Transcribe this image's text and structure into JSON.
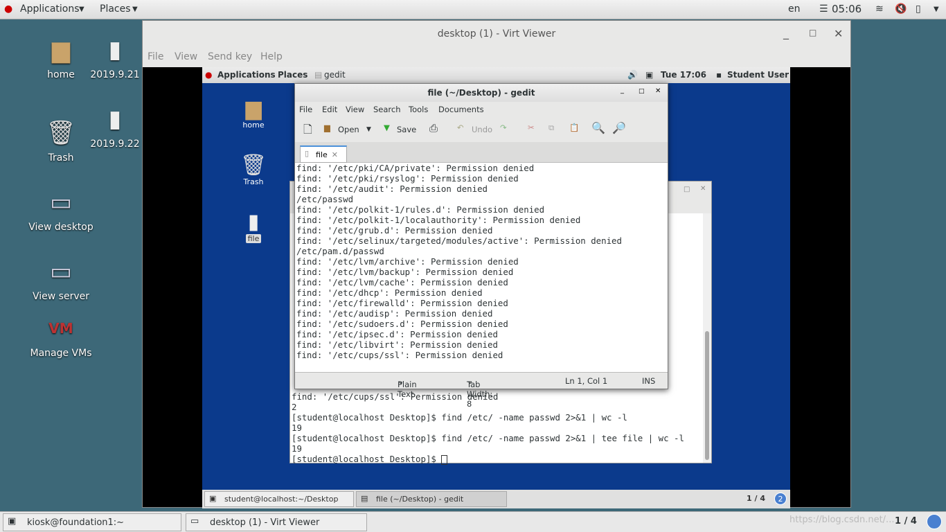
{
  "host_topbar": {
    "applications": "Applications",
    "places": "Places",
    "lang": "en",
    "time": "05:06"
  },
  "host_desktop": [
    {
      "label": "home",
      "icon": "folder-home-icon"
    },
    {
      "label": "2019.9.21",
      "icon": "file-icon"
    },
    {
      "label": "Trash",
      "icon": "trash-icon"
    },
    {
      "label": "2019.9.22",
      "icon": "file-icon"
    },
    {
      "label": "View desktop",
      "icon": "monitor-icon"
    },
    {
      "label": "View server",
      "icon": "monitor-icon"
    },
    {
      "label": "Manage VMs",
      "icon": "vm-icon"
    }
  ],
  "virt_viewer": {
    "title": "desktop (1) - Virt Viewer",
    "menu": [
      "File",
      "View",
      "Send key",
      "Help"
    ]
  },
  "guest_topbar": {
    "applications": "Applications",
    "places": "Places",
    "gedit": "gedit",
    "time": "Tue 17:06",
    "user": "Student User"
  },
  "guest_desktop": [
    {
      "label": "home"
    },
    {
      "label": "Trash"
    },
    {
      "label": "file"
    }
  ],
  "terminal": {
    "lines": [
      "find: '/etc/cups/ssl': Permission denied",
      "2",
      "[student@localhost Desktop]$ find /etc/ -name passwd 2>&1 | wc -l",
      "19",
      "[student@localhost Desktop]$ find /etc/ -name passwd 2>&1 | tee file | wc -l",
      "19",
      "[student@localhost Desktop]$ "
    ]
  },
  "gedit": {
    "title": "file (~/Desktop) - gedit",
    "menu": [
      "File",
      "Edit",
      "View",
      "Search",
      "Tools",
      "Documents"
    ],
    "toolbar": {
      "open": "Open",
      "save": "Save",
      "undo": "Undo"
    },
    "tab": "file",
    "lines": [
      "find: '/etc/pki/CA/private': Permission denied",
      "find: '/etc/pki/rsyslog': Permission denied",
      "find: '/etc/audit': Permission denied",
      "/etc/passwd",
      "find: '/etc/polkit-1/rules.d': Permission denied",
      "find: '/etc/polkit-1/localauthority': Permission denied",
      "find: '/etc/grub.d': Permission denied",
      "find: '/etc/selinux/targeted/modules/active': Permission denied",
      "/etc/pam.d/passwd",
      "find: '/etc/lvm/archive': Permission denied",
      "find: '/etc/lvm/backup': Permission denied",
      "find: '/etc/lvm/cache': Permission denied",
      "find: '/etc/dhcp': Permission denied",
      "find: '/etc/firewalld': Permission denied",
      "find: '/etc/audisp': Permission denied",
      "find: '/etc/sudoers.d': Permission denied",
      "find: '/etc/ipsec.d': Permission denied",
      "find: '/etc/libvirt': Permission denied",
      "find: '/etc/cups/ssl': Permission denied"
    ],
    "status": {
      "lang": "Plain Text",
      "tab_width": "Tab Width:  8",
      "position": "Ln 1, Col 1",
      "mode": "INS"
    }
  },
  "guest_taskbar": {
    "items": [
      "student@localhost:~/Desktop",
      "file (~/Desktop) - gedit"
    ],
    "workspace": "1 / 4",
    "badge": "2"
  },
  "host_taskbar": {
    "items": [
      "kiosk@foundation1:~",
      "desktop (1) - Virt Viewer"
    ],
    "workspace": "1 / 4",
    "watermark": "https://blog.csdn.net/..."
  }
}
